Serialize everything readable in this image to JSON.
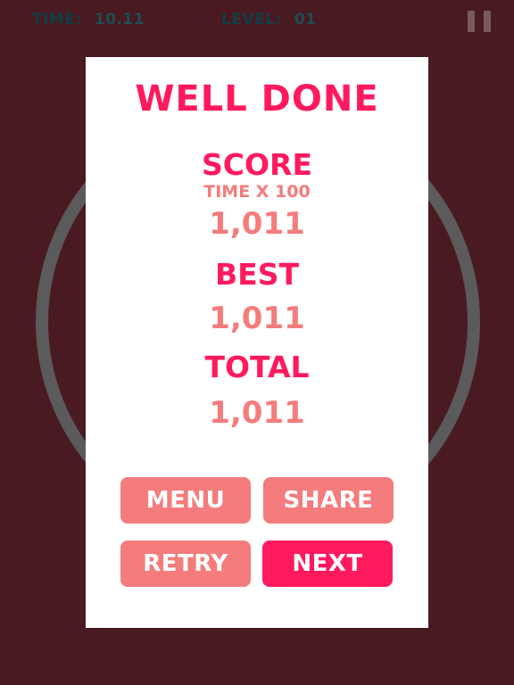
{
  "hud": {
    "time_label": "TIME:",
    "time_value": "10.11",
    "level_label": "LEVEL:",
    "level_value": "01"
  },
  "dialog": {
    "title": "WELL DONE",
    "score_label": "SCORE",
    "score_sub": "TIME X 100",
    "score_value": "1,011",
    "best_label": "BEST",
    "best_value": "1,011",
    "total_label": "TOTAL",
    "total_value": "1,011"
  },
  "buttons": {
    "menu": "MENU",
    "share": "SHARE",
    "retry": "RETRY",
    "next": "NEXT"
  },
  "colors": {
    "background": "#4a1a22",
    "accent": "#ff1a5e",
    "secondary": "#f47c7c",
    "hud_text": "#0f3f44",
    "ring": "#5b5b5b"
  },
  "icons": {
    "pause": "pause-icon"
  }
}
